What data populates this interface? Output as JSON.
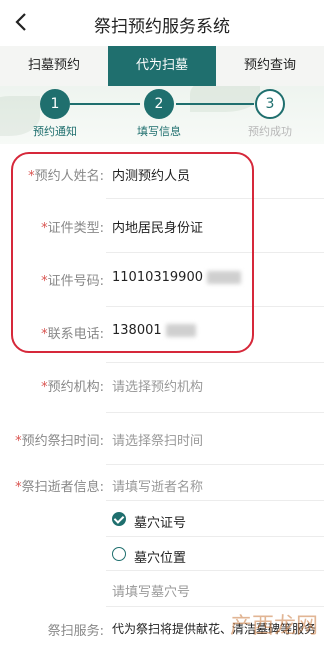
{
  "nav": {
    "title": "祭扫预约服务系统"
  },
  "tabs": [
    {
      "label": "扫墓预约"
    },
    {
      "label": "代为扫墓"
    },
    {
      "label": "预约查询"
    }
  ],
  "steps": [
    {
      "num": "1",
      "label": "预约通知"
    },
    {
      "num": "2",
      "label": "填写信息"
    },
    {
      "num": "3",
      "label": "预约成功"
    }
  ],
  "form": {
    "name": {
      "required": "*",
      "label": "预约人姓名:",
      "value": "内测预约人员"
    },
    "idtype": {
      "required": "*",
      "label": "证件类型:",
      "value": "内地居民身份证"
    },
    "idnum": {
      "required": "*",
      "label": "证件号码:",
      "value": "11010319900"
    },
    "phone": {
      "required": "*",
      "label": "联系电话:",
      "value": "138001"
    },
    "org": {
      "required": "*",
      "label": "预约机构:",
      "placeholder": "请选择预约机构"
    },
    "time": {
      "required": "*",
      "label": "预约祭扫时间:",
      "placeholder": "请选择祭扫时间"
    },
    "deceased": {
      "required": "*",
      "label": "祭扫逝者信息:",
      "placeholder": "请填写逝者名称"
    },
    "tomb_option1": "墓穴证号",
    "tomb_option2": "墓穴位置",
    "tomb_placeholder": "请填写墓穴号",
    "service": {
      "label": "祭扫服务:",
      "value": "代为祭扫将提供献花、清洁墓碑等服务"
    }
  },
  "watermark": "产西龙网"
}
